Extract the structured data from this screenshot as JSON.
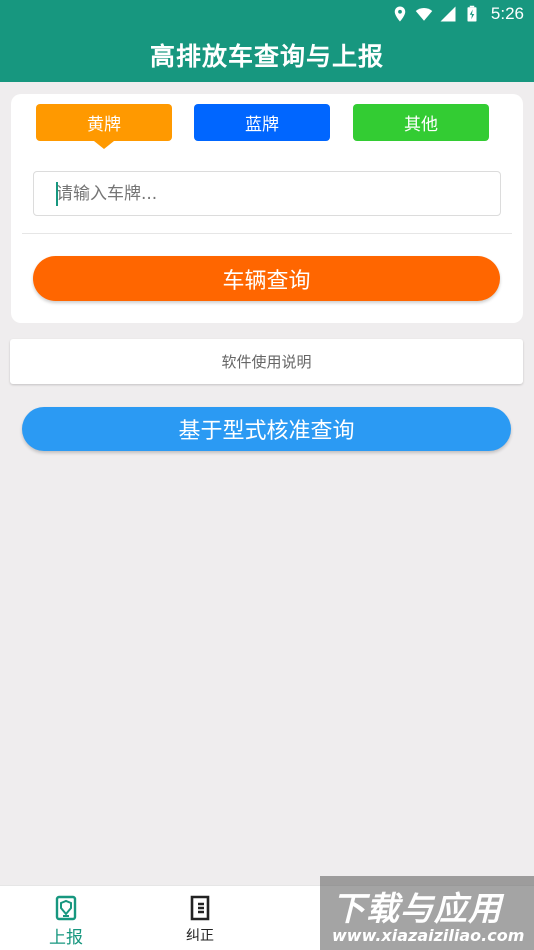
{
  "status_bar": {
    "time": "5:26",
    "icons": [
      "location-icon",
      "wifi-icon",
      "signal-icon",
      "battery-charging-icon"
    ]
  },
  "header": {
    "title": "高排放车查询与上报"
  },
  "plate_types": {
    "yellow": "黄牌",
    "blue": "蓝牌",
    "other": "其他"
  },
  "search": {
    "placeholder": "请输入车牌...",
    "value": ""
  },
  "buttons": {
    "vehicle_query": "车辆查询",
    "manual": "软件使用说明",
    "type_approval_query": "基于型式核准查询"
  },
  "bottom_nav": {
    "report": "上报",
    "correct": "纠正"
  },
  "watermark": {
    "title": "下载与应用",
    "url": "www.xiazaiziliao.com"
  },
  "colors": {
    "primary": "#17977f",
    "yellow_plate": "#ff9900",
    "blue_plate": "#0066ff",
    "other_plate": "#33cc33",
    "query_button": "#ff6600",
    "type_button": "#2b9af3"
  }
}
